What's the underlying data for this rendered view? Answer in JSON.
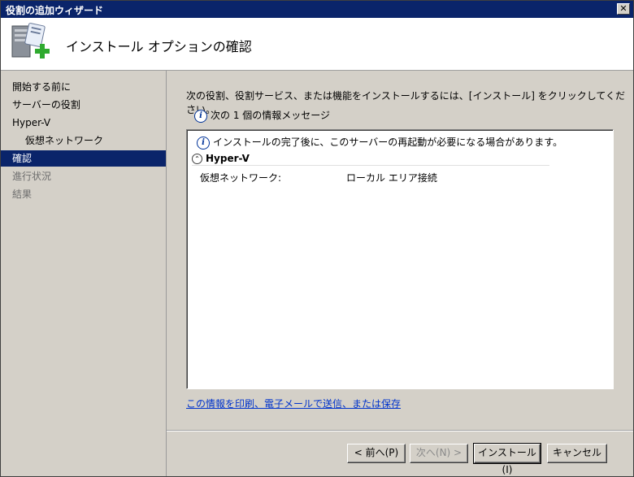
{
  "window": {
    "title": "役割の追加ウィザード",
    "close_label": "✕"
  },
  "header": {
    "title": "インストール オプションの確認"
  },
  "sidebar": {
    "items": [
      {
        "label": "開始する前に",
        "state": "normal"
      },
      {
        "label": "サーバーの役割",
        "state": "normal"
      },
      {
        "label": "Hyper-V",
        "state": "normal"
      },
      {
        "label": "仮想ネットワーク",
        "state": "normal",
        "sub": true
      },
      {
        "label": "確認",
        "state": "active"
      },
      {
        "label": "進行状況",
        "state": "disabled"
      },
      {
        "label": "結果",
        "state": "disabled"
      }
    ]
  },
  "main": {
    "intro": "次の役割、役割サービス、または機能をインストールするには、[インストール] をクリックしてください。",
    "message_count": "次の 1 個の情報メッセージ",
    "warning": "インストールの完了後に、このサーバーの再起動が必要になる場合があります。",
    "section_title": "Hyper-V",
    "row_label": "仮想ネットワーク:",
    "row_value": "ローカル エリア接続",
    "link": "この情報を印刷、電子メールで送信、または保存"
  },
  "buttons": {
    "prev": "< 前へ(P)",
    "next": "次へ(N) >",
    "install": "インストール(I)",
    "cancel": "キャンセル"
  },
  "icons": {
    "wizard": "server-add-icon",
    "info": "info-icon",
    "collapse": "collapse-icon"
  },
  "colors": {
    "titlebar": "#0a246a",
    "selection": "#0a246a",
    "link": "#0033cc",
    "face": "#d4d0c8"
  }
}
